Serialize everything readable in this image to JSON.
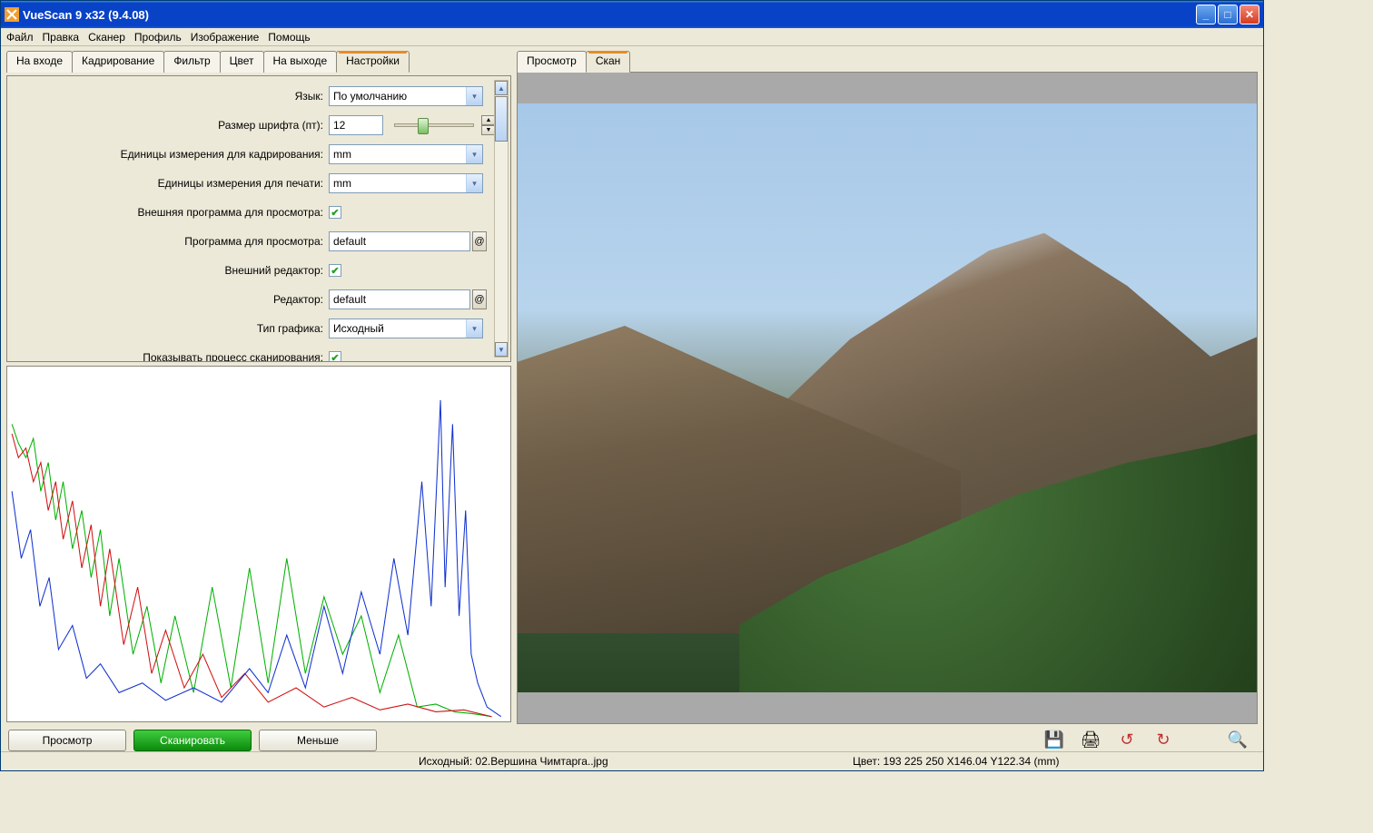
{
  "window": {
    "title": "VueScan 9 x32 (9.4.08)"
  },
  "menu": [
    "Файл",
    "Правка",
    "Сканер",
    "Профиль",
    "Изображение",
    "Помощь"
  ],
  "left_tabs": [
    "На входе",
    "Кадрирование",
    "Фильтр",
    "Цвет",
    "На выходе",
    "Настройки"
  ],
  "left_active": 5,
  "right_tabs": [
    "Просмотр",
    "Скан"
  ],
  "right_active": 1,
  "settings": {
    "language_label": "Язык:",
    "language_value": "По умолчанию",
    "fontsize_label": "Размер шрифта (пт):",
    "fontsize_value": "12",
    "crop_units_label": "Единицы измерения для кадрирования:",
    "crop_units_value": "mm",
    "print_units_label": "Единицы измерения для печати:",
    "print_units_value": "mm",
    "ext_viewer_label": "Внешняя программа для просмотра:",
    "viewer_label": "Программа для просмотра:",
    "viewer_value": "default",
    "ext_editor_label": "Внешний редактор:",
    "editor_label": "Редактор:",
    "editor_value": "default",
    "graph_type_label": "Тип графика:",
    "graph_type_value": "Исходный",
    "show_progress_label": "Показывать процесс сканирования:"
  },
  "buttons": {
    "preview": "Просмотр",
    "scan": "Сканировать",
    "less": "Меньше"
  },
  "status": {
    "file": "Исходный: 02.Вершина Чимтарга..jpg",
    "info": "Цвет: 193 225 250   X146.04   Y122.34 (mm)"
  },
  "icons": {
    "save": "💾",
    "print": "🖨",
    "rotl": "↺",
    "rotr": "↻",
    "zoom": "🔍"
  }
}
